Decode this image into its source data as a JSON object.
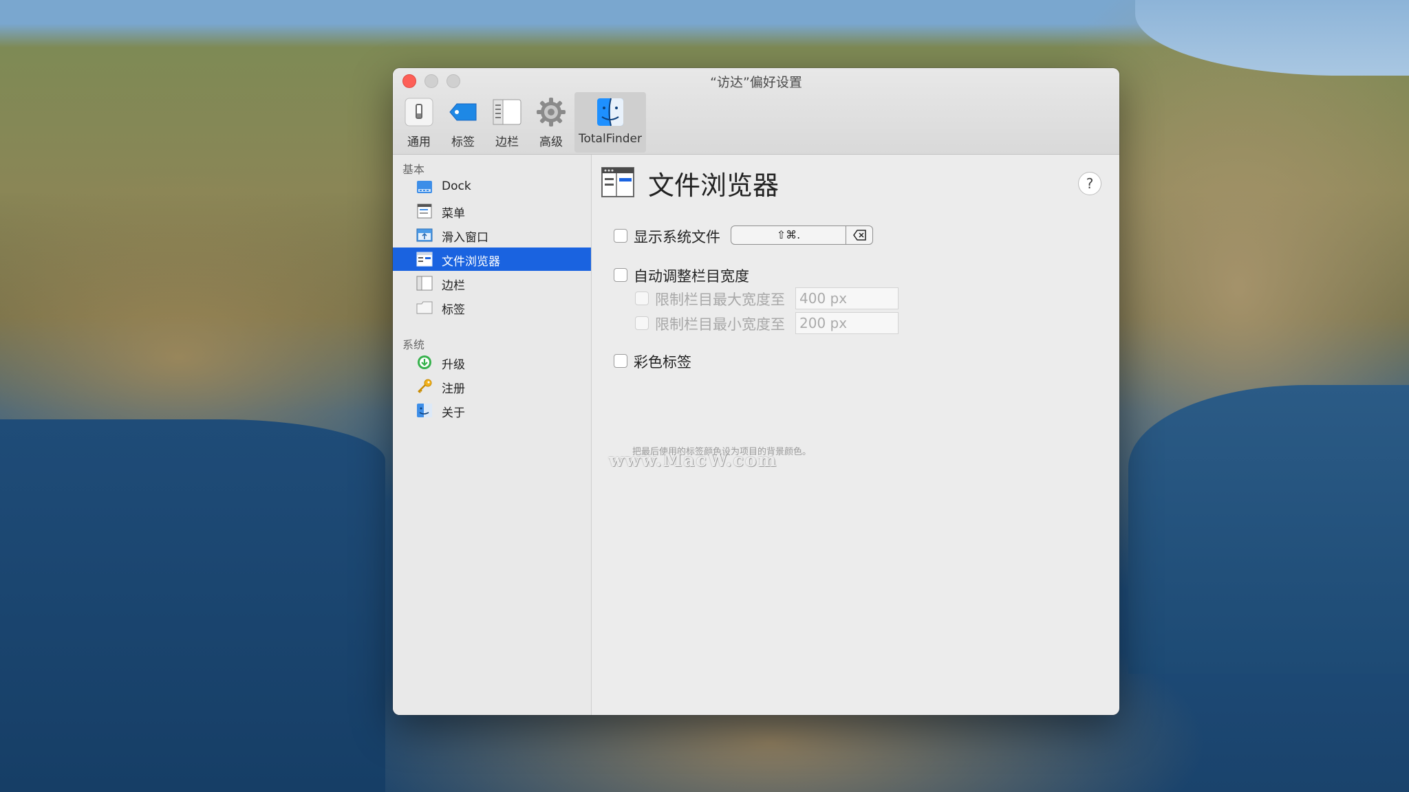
{
  "window": {
    "title": "“访达”偏好设置"
  },
  "toolbar": {
    "items": [
      {
        "label": "通用",
        "icon": "general-icon"
      },
      {
        "label": "标签",
        "icon": "tag-icon"
      },
      {
        "label": "边栏",
        "icon": "sidebar-icon"
      },
      {
        "label": "高级",
        "icon": "gear-icon"
      },
      {
        "label": "TotalFinder",
        "icon": "finder-icon",
        "selected": true
      }
    ]
  },
  "sidebar": {
    "basic_header": "基本",
    "basic_items": [
      {
        "label": "Dock",
        "icon": "dock-icon"
      },
      {
        "label": "菜单",
        "icon": "menu-icon"
      },
      {
        "label": "滑入窗口",
        "icon": "slide-window-icon"
      },
      {
        "label": "文件浏览器",
        "icon": "file-browser-icon",
        "active": true
      },
      {
        "label": "边栏",
        "icon": "sidebar-icon"
      },
      {
        "label": "标签",
        "icon": "tabs-icon"
      }
    ],
    "system_header": "系统",
    "system_items": [
      {
        "label": "升级",
        "icon": "upgrade-icon"
      },
      {
        "label": "注册",
        "icon": "key-icon"
      },
      {
        "label": "关于",
        "icon": "about-icon"
      }
    ]
  },
  "main": {
    "title": "文件浏览器",
    "help_label": "?",
    "show_system_files": {
      "label": "显示系统文件",
      "checked": false,
      "shortcut": "⇧⌘."
    },
    "auto_column_width": {
      "label": "自动调整栏目宽度",
      "checked": false
    },
    "limit_max": {
      "label": "限制栏目最大宽度至",
      "value": "400 px",
      "enabled": false
    },
    "limit_min": {
      "label": "限制栏目最小宽度至",
      "value": "200 px",
      "enabled": false
    },
    "color_tags": {
      "label": "彩色标签",
      "checked": false,
      "hint": "把最后使用的标签颜色设为项目的背景颜色。"
    },
    "watermark": "www.MacW.com"
  },
  "colors": {
    "accent": "#1a63e0",
    "close": "#fd5f57"
  }
}
